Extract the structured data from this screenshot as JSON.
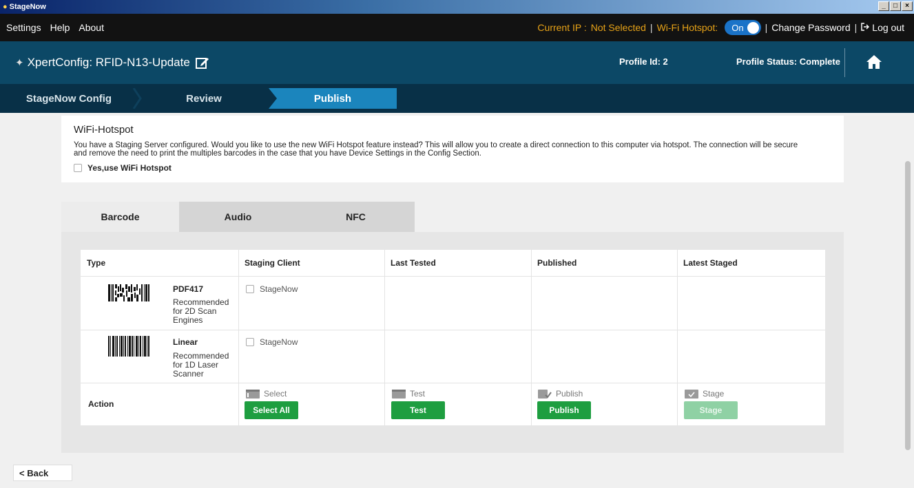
{
  "window": {
    "title": "StageNow",
    "controls": [
      "_",
      "□",
      "×"
    ]
  },
  "menu": {
    "items": [
      "Settings",
      "Help",
      "About"
    ],
    "current_ip_label": "Current IP :",
    "current_ip_value": "Not Selected",
    "hotspot_label": "Wi-Fi Hotspot:",
    "hotspot_toggle": "On",
    "separator": "|",
    "change_password": "Change Password",
    "logout": "Log out"
  },
  "header": {
    "title": "XpertConfig: RFID-N13-Update",
    "profile_id": "Profile Id: 2",
    "profile_status": "Profile Status: Complete"
  },
  "steps": [
    "StageNow Config",
    "Review",
    "Publish"
  ],
  "hotspot": {
    "heading": "WiFi-Hotspot",
    "text_line1": "You have a Staging Server configured. Would you like to use the new WiFi Hotspot feature instead? This will allow you to create a direct connection to this computer via hotspot. The connection will be secure",
    "text_line2": "and remove the need to print the multiples barcodes in the case that you have Device Settings in the Config Section.",
    "checkbox_label": "Yes,use WiFi Hotspot"
  },
  "tabs": [
    "Barcode",
    "Audio",
    "NFC"
  ],
  "table": {
    "headers": [
      "Type",
      "Staging Client",
      "Last Tested",
      "Published",
      "Latest Staged"
    ],
    "rows": [
      {
        "name": "PDF417",
        "desc": "Recommended for 2D Scan Engines",
        "client": "StageNow"
      },
      {
        "name": "Linear",
        "desc": "Recommended for 1D Laser Scanner",
        "client": "StageNow"
      }
    ],
    "action": {
      "label": "Action",
      "select_label": "Select",
      "select_btn": "Select All",
      "test_label": "Test",
      "test_btn": "Test",
      "publish_label": "Publish",
      "publish_btn": "Publish",
      "stage_label": "Stage",
      "stage_btn": "Stage"
    }
  },
  "back_button": "< Back",
  "colors": {
    "header_bg": "#0c4866",
    "stepbar_bg": "#083047",
    "active_step": "#1b85bd",
    "accent_orange": "#e8a317",
    "toggle_blue": "#1a73c8",
    "button_green": "#1e9e40"
  }
}
